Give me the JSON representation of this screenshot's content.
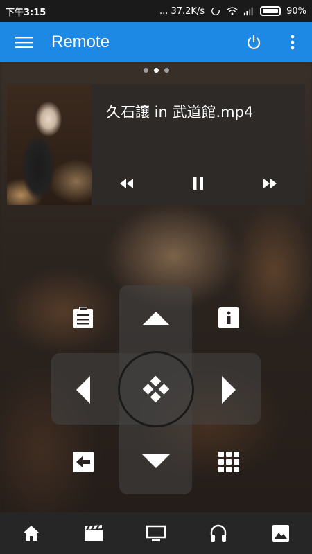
{
  "status_bar": {
    "time": "下午3:15",
    "network_speed": "... 37.2K/s",
    "battery": "90%"
  },
  "app_bar": {
    "title": "Remote",
    "menu_icon": "hamburger-icon",
    "power_icon": "power-icon",
    "overflow_icon": "more-vert-icon"
  },
  "pager": {
    "pages": 3,
    "active_index": 1
  },
  "now_playing": {
    "file_name": "久石讓 in 武道館.mp4",
    "controls": [
      "rewind-icon",
      "pause-icon",
      "fast-forward-icon"
    ]
  },
  "remote": {
    "buttons": [
      "clipboard-list-icon",
      "up-arrow-icon",
      "info-icon",
      "left-arrow-icon",
      "select-icon",
      "right-arrow-icon",
      "back-icon",
      "down-arrow-icon",
      "grid-icon"
    ]
  },
  "bottom_nav": {
    "items": [
      "home-icon",
      "movies-icon",
      "tv-icon",
      "music-icon",
      "pictures-icon"
    ]
  },
  "colors": {
    "accent": "#1e88e5",
    "status_bar": "#1a1a1a",
    "bottom_bar": "#262626",
    "card": "#2d2a28"
  }
}
